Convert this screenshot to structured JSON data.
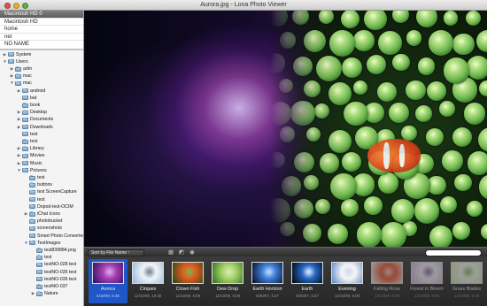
{
  "window": {
    "title": "Aurora.jpg - Lona Photo Viewer"
  },
  "sidebar": {
    "volumes": [
      {
        "label": "Macintosh HD 0",
        "selected": true
      },
      {
        "label": "Macintosh HD",
        "selected": false
      },
      {
        "label": "home",
        "selected": false
      },
      {
        "label": "net",
        "selected": false
      },
      {
        "label": "NO NAME",
        "selected": false
      }
    ],
    "tree": [
      {
        "label": "System",
        "depth": 0,
        "arrow": "collapsed"
      },
      {
        "label": "Users",
        "depth": 0,
        "arrow": "expanded"
      },
      {
        "label": "adm",
        "depth": 1,
        "arrow": "collapsed"
      },
      {
        "label": "mac",
        "depth": 1,
        "arrow": "collapsed"
      },
      {
        "label": "mac",
        "depth": 1,
        "arrow": "expanded"
      },
      {
        "label": "android",
        "depth": 2,
        "arrow": "collapsed"
      },
      {
        "label": "bat",
        "depth": 2,
        "arrow": "none"
      },
      {
        "label": "book",
        "depth": 2,
        "arrow": "none"
      },
      {
        "label": "Desktop",
        "depth": 2,
        "arrow": "collapsed"
      },
      {
        "label": "Documents",
        "depth": 2,
        "arrow": "collapsed"
      },
      {
        "label": "Downloads",
        "depth": 2,
        "arrow": "collapsed"
      },
      {
        "label": "test",
        "depth": 2,
        "arrow": "none"
      },
      {
        "label": "test",
        "depth": 2,
        "arrow": "none"
      },
      {
        "label": "Library",
        "depth": 2,
        "arrow": "collapsed"
      },
      {
        "label": "Movies",
        "depth": 2,
        "arrow": "collapsed"
      },
      {
        "label": "Music",
        "depth": 2,
        "arrow": "collapsed"
      },
      {
        "label": "Pictures",
        "depth": 2,
        "arrow": "expanded"
      },
      {
        "label": "test",
        "depth": 3,
        "arrow": "none"
      },
      {
        "label": "buttons",
        "depth": 3,
        "arrow": "none"
      },
      {
        "label": "test ScreenCapture",
        "depth": 3,
        "arrow": "none"
      },
      {
        "label": "test",
        "depth": 3,
        "arrow": "none"
      },
      {
        "label": "Dopod-test-OCIM",
        "depth": 3,
        "arrow": "none"
      },
      {
        "label": "iChat Icons",
        "depth": 3,
        "arrow": "collapsed"
      },
      {
        "label": "photobucket",
        "depth": 3,
        "arrow": "none"
      },
      {
        "label": "screenshots",
        "depth": 3,
        "arrow": "none"
      },
      {
        "label": "Smart Photo Converter",
        "depth": 3,
        "arrow": "none"
      },
      {
        "label": "TestImages",
        "depth": 3,
        "arrow": "expanded"
      },
      {
        "label": "test839884.png",
        "depth": 4,
        "arrow": "none"
      },
      {
        "label": "test",
        "depth": 4,
        "arrow": "none"
      },
      {
        "label": "testNO-028 test",
        "depth": 4,
        "arrow": "none"
      },
      {
        "label": "testNO-035 test",
        "depth": 4,
        "arrow": "none"
      },
      {
        "label": "testNO-036 test",
        "depth": 4,
        "arrow": "none"
      },
      {
        "label": "testNO-037",
        "depth": 4,
        "arrow": "none"
      },
      {
        "label": "Nature",
        "depth": 4,
        "arrow": "collapsed"
      }
    ]
  },
  "toolbar": {
    "sort_label": "Sort by File Name ↑",
    "icons": [
      "grid-icon",
      "color-swatch-icon",
      "info-icon"
    ],
    "search_placeholder": ""
  },
  "filmstrip": [
    {
      "name": "Aurora",
      "date": "5/19/09, 5:46",
      "active": true,
      "colors": [
        "#27105a",
        "#a63fb3",
        "#e0b0f0"
      ]
    },
    {
      "name": "Cirques",
      "date": "12/10/09, 10:40",
      "active": false,
      "colors": [
        "#8fb6d9",
        "#f2f5f8",
        "#6f7f8f"
      ]
    },
    {
      "name": "Clown Fish",
      "date": "12/10/09, 5:09",
      "active": false,
      "colors": [
        "#1f4a16",
        "#e25a20",
        "#79b84e"
      ]
    },
    {
      "name": "Dew Drop",
      "date": "12/10/09, 5:09",
      "active": false,
      "colors": [
        "#2e6d1e",
        "#a7d46a",
        "#dfeac0"
      ]
    },
    {
      "name": "Earth Horizon",
      "date": "8/30/07, 4:27",
      "active": false,
      "colors": [
        "#05081a",
        "#3d7ed6",
        "#c6e0ff"
      ]
    },
    {
      "name": "Earth",
      "date": "8/30/07, 4:27",
      "active": false,
      "colors": [
        "#000000",
        "#2466c2",
        "#e9f1ff"
      ]
    },
    {
      "name": "Evening",
      "date": "12/10/09, 5:09",
      "active": false,
      "colors": [
        "#5a84c0",
        "#f5f5f7",
        "#cfd8e8"
      ]
    },
    {
      "name": "Falling Rose",
      "date": "12/10/09, 5:09",
      "active": false,
      "colors": [
        "#f4f4f4",
        "#e85d3a",
        "#f8c8b8"
      ]
    },
    {
      "name": "Forest in Bloom",
      "date": "12/10/09, 5:09",
      "active": false,
      "colors": [
        "#c9b2d8",
        "#f3eef7",
        "#8f6fb4"
      ]
    },
    {
      "name": "Grass Blades",
      "date": "12/10/09, 5:09",
      "active": false,
      "colors": [
        "#cfe2b0",
        "#f2f6ea",
        "#8db366"
      ]
    }
  ],
  "colors": {
    "accent": "#1f57c8",
    "sidebar_bg": "#f4f4f4",
    "viewer_bg": "#000000"
  }
}
